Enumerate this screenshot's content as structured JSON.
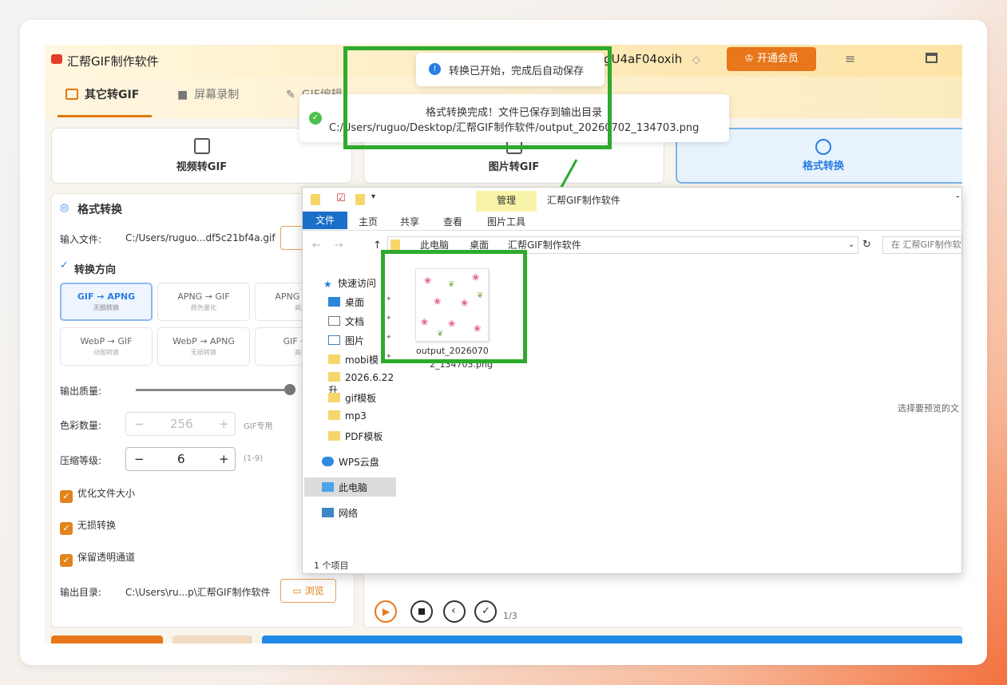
{
  "app": {
    "title": "汇帮GIF制作软件",
    "user": "gU4aF04oxih",
    "vip_button": "开通会员"
  },
  "tabs": [
    {
      "label": "其它转GIF"
    },
    {
      "label": "屏幕录制"
    },
    {
      "label": "GIF编辑"
    }
  ],
  "cards": [
    {
      "label": "视频转GIF"
    },
    {
      "label": "图片转GIF"
    },
    {
      "label": "格式转换"
    }
  ],
  "panel": {
    "title": "格式转换",
    "input_label": "输入文件:",
    "input_value": "C:/Users/ruguo...df5c21bf4a.gif",
    "direction_title": "转换方向",
    "formats": [
      {
        "name": "GIF → APNG",
        "sub": "无损转换"
      },
      {
        "name": "APNG → GIF",
        "sub": "颜色量化"
      },
      {
        "name": "APNG → GIF",
        "sub": "高效"
      },
      {
        "name": "WebP → GIF",
        "sub": "动图转换"
      },
      {
        "name": "WebP → APNG",
        "sub": "无损转换"
      },
      {
        "name": "GIF → ...",
        "sub": "高效"
      }
    ],
    "quality_label": "输出质量:",
    "colors_label": "色彩数量:",
    "colors_value": "256",
    "colors_hint": "GIF专用",
    "compress_label": "压缩等级:",
    "compress_value": "6",
    "compress_hint": "(1-9)",
    "opt1": "优化文件大小",
    "opt2": "无损转换",
    "opt3": "保留透明通道",
    "output_label": "输出目录:",
    "output_value": "C:\\Users\\ru...p\\汇帮GIF制作软件",
    "browse": "浏览"
  },
  "toasts": {
    "info": "转换已开始，完成后自动保存",
    "success_line1": "格式转换完成！文件已保存到输出目录",
    "success_line2": "C:/Users/ruguo/Desktop/汇帮GIF制作软件/output_20260702_134703.png"
  },
  "explorer": {
    "title": "汇帮GIF制作软件",
    "ribbon_manage": "管理",
    "ribbon_tabs": [
      "文件",
      "主页",
      "共享",
      "查看",
      "图片工具"
    ],
    "breadcrumb": [
      "此电脑",
      "桌面",
      "汇帮GIF制作软件"
    ],
    "search_placeholder": "在 汇帮GIF制作软",
    "nav": [
      "快速访问",
      "桌面",
      "文档",
      "图片",
      "mobi模",
      "2026.6.22升",
      "gif模板",
      "mp3",
      "PDF模板",
      "WPS云盘",
      "此电脑",
      "网络"
    ],
    "file_name_1": "output_2026070",
    "file_name_2": "2_134703.png",
    "preview_hint": "选择要预览的文",
    "status": "1 个项目"
  },
  "player": {
    "page": "1/3"
  }
}
